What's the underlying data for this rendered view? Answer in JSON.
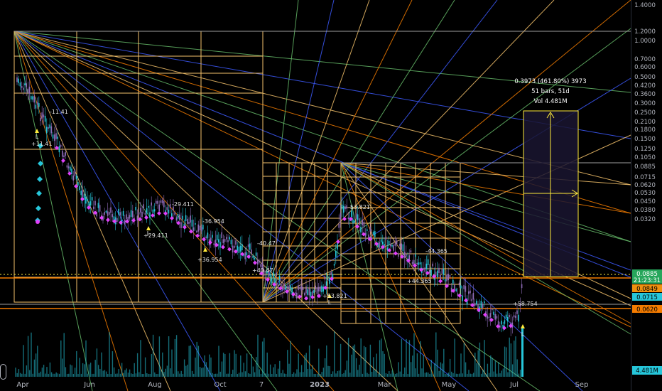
{
  "chart_data": {
    "type": "candlestick",
    "scale": "log",
    "price_axis": {
      "ticks": [
        "1.2000",
        "1.0000",
        "0.7000",
        "0.6000",
        "0.5000",
        "0.4200",
        "0.3600",
        "0.3000",
        "0.2500",
        "0.2100",
        "0.1800",
        "0.1500",
        "0.1250",
        "0.1050",
        "0.0885",
        "0.0715",
        "0.0620",
        "0.0530",
        "0.0450",
        "0.0380",
        "0.0320"
      ],
      "top_label": "1.4000"
    },
    "time_axis": {
      "ticks": [
        "Apr",
        "Jun",
        "Aug",
        "Oct",
        "7",
        "2023",
        "Mar",
        "May",
        "Jul",
        "Sep"
      ]
    },
    "price_tags": [
      {
        "label": "0.0885",
        "sub": "21:23:31",
        "color": "#26a65b",
        "text_color": "#ffffff"
      },
      {
        "label": "0.0849",
        "color": "#f0900f",
        "text_color": "#000000"
      },
      {
        "label": "0.0715",
        "color": "#26c6da",
        "text_color": "#000000"
      },
      {
        "label": "0.0620",
        "color": "#f57c00",
        "text_color": "#000000"
      }
    ],
    "volume_tag": {
      "label": "4.481M",
      "color": "#26c6da"
    },
    "annotations": [
      {
        "label": "+11.41"
      },
      {
        "label": "-11.41"
      },
      {
        "label": "-29.411"
      },
      {
        "label": "+29.411"
      },
      {
        "label": "-36.954"
      },
      {
        "label": "+36.954"
      },
      {
        "label": "-40.47"
      },
      {
        "label": "+40.47"
      },
      {
        "label": "-53.821"
      },
      {
        "label": "+53.821"
      },
      {
        "label": "-44.365"
      },
      {
        "label": "+44.365"
      },
      {
        "label": "+58.754"
      }
    ],
    "pivot_letters": [
      "L",
      "L",
      "L",
      "L"
    ],
    "measure": {
      "line1": "0.3973 (461.80%) 3973",
      "line2": "51 bars, 51d",
      "line3": "Vol 4.481M"
    },
    "colors": {
      "grid_box": "#f5c26b",
      "fan_orange": "#f57c00",
      "fan_green": "#66bb6a",
      "fan_blue": "#3d5afe",
      "candle_up": "#26c6da",
      "candle_down": "#8e6bb8",
      "marker_magenta": "#e040fb",
      "marker_cyan": "#26c6da",
      "marker_yellow": "#ffeb3b",
      "volume": "#26c6da",
      "measure_fill": "#1a1530",
      "measure_border": "#ffeb3b"
    }
  }
}
